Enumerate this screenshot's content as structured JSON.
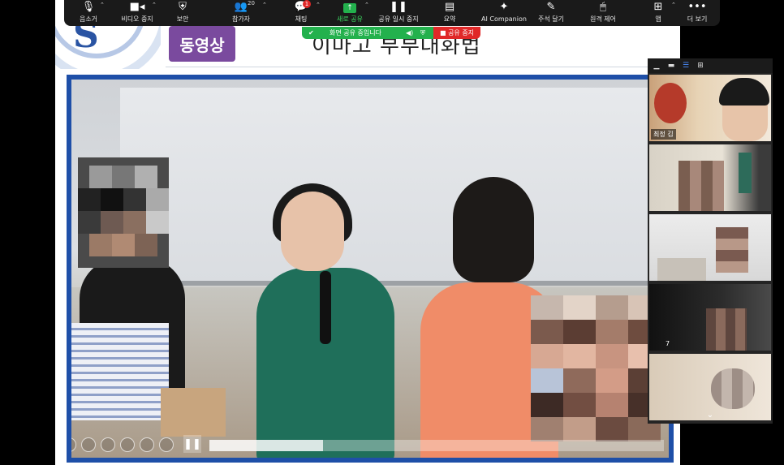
{
  "toolbar": {
    "items": [
      {
        "label": "음소거",
        "icon": "microphone-icon"
      },
      {
        "label": "비디오 중지",
        "icon": "video-camera-icon"
      },
      {
        "label": "보안",
        "icon": "shield-icon"
      },
      {
        "label": "참가자",
        "icon": "participants-icon",
        "count": "20"
      },
      {
        "label": "채팅",
        "icon": "chat-icon",
        "badge": "1"
      },
      {
        "label": "새로 공유",
        "icon": "share-screen-icon"
      },
      {
        "label": "공유 일시 중지",
        "icon": "pause-icon"
      },
      {
        "label": "요약",
        "icon": "summary-icon"
      },
      {
        "label": "AI Companion",
        "icon": "sparkle-icon"
      },
      {
        "label": "주석 달기",
        "icon": "pen-icon"
      },
      {
        "label": "원격 제어",
        "icon": "mouse-icon"
      },
      {
        "label": "앱",
        "icon": "apps-icon"
      },
      {
        "label": "더 보기",
        "icon": "more-icon"
      }
    ]
  },
  "share_banner": {
    "text": "화면 공유 중입니다",
    "stop_label": "공유 중지"
  },
  "slide": {
    "logo_letter": "S",
    "badge": "동영상",
    "title": "이마고 부부대화법"
  },
  "video": {
    "progress_fraction": 0.25
  },
  "gallery": {
    "tiles": [
      {
        "name": "최정 김"
      },
      {
        "name": ""
      },
      {
        "name": ""
      },
      {
        "name": "",
        "number": "7"
      },
      {
        "name": ""
      }
    ]
  },
  "colors": {
    "toolbar_bg": "#1a1a1a",
    "share_green": "#23b14d",
    "stop_red": "#e02828",
    "slide_badge": "#7a4a9e",
    "video_border": "#1e4fa8"
  }
}
